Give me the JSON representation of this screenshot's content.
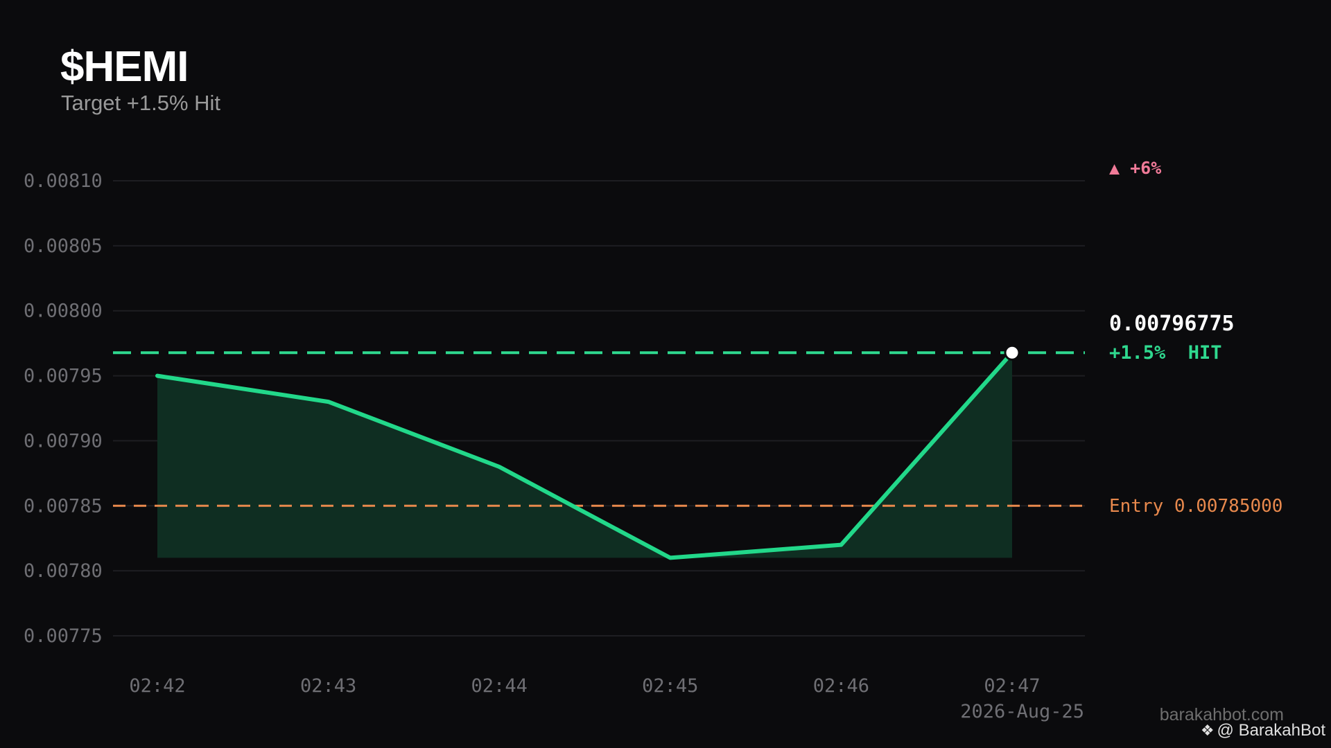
{
  "header": {
    "title": "$HEMI",
    "subtitle": "Target +1.5% Hit"
  },
  "footer": {
    "date": "2026-Aug-25",
    "site": "barakahbot.com",
    "watermark": "@ BarakahBot"
  },
  "annotations": {
    "top_marker": "▲ +6%",
    "current_price": "0.00796775",
    "target_label": "+1.5%  HIT",
    "entry_label": "Entry 0.00785000"
  },
  "colors": {
    "background": "#0b0b0d",
    "line": "#22d88a",
    "area": "#0f2e22",
    "target": "#2fd98f",
    "entry": "#e8894d",
    "top_marker": "#f07a98",
    "grid": "#1e1e22",
    "tick": "#6f6f74",
    "price": "#ffffff"
  },
  "chart_data": {
    "type": "line",
    "title": "$HEMI",
    "subtitle": "Target +1.5% Hit",
    "x": [
      "02:42",
      "02:43",
      "02:44",
      "02:45",
      "02:46",
      "02:47"
    ],
    "series": [
      {
        "values": [
          0.00795,
          0.00793,
          0.00788,
          0.00781,
          0.00782,
          0.00796775
        ]
      }
    ],
    "yticks": [
      "0.00810",
      "0.00805",
      "0.00800",
      "0.00795",
      "0.00790",
      "0.00785",
      "0.00780",
      "0.00775"
    ],
    "ylim": [
      0.00775,
      0.0081
    ],
    "entry": 0.00785,
    "target": 0.00796775,
    "grid": true,
    "fill": "area"
  }
}
